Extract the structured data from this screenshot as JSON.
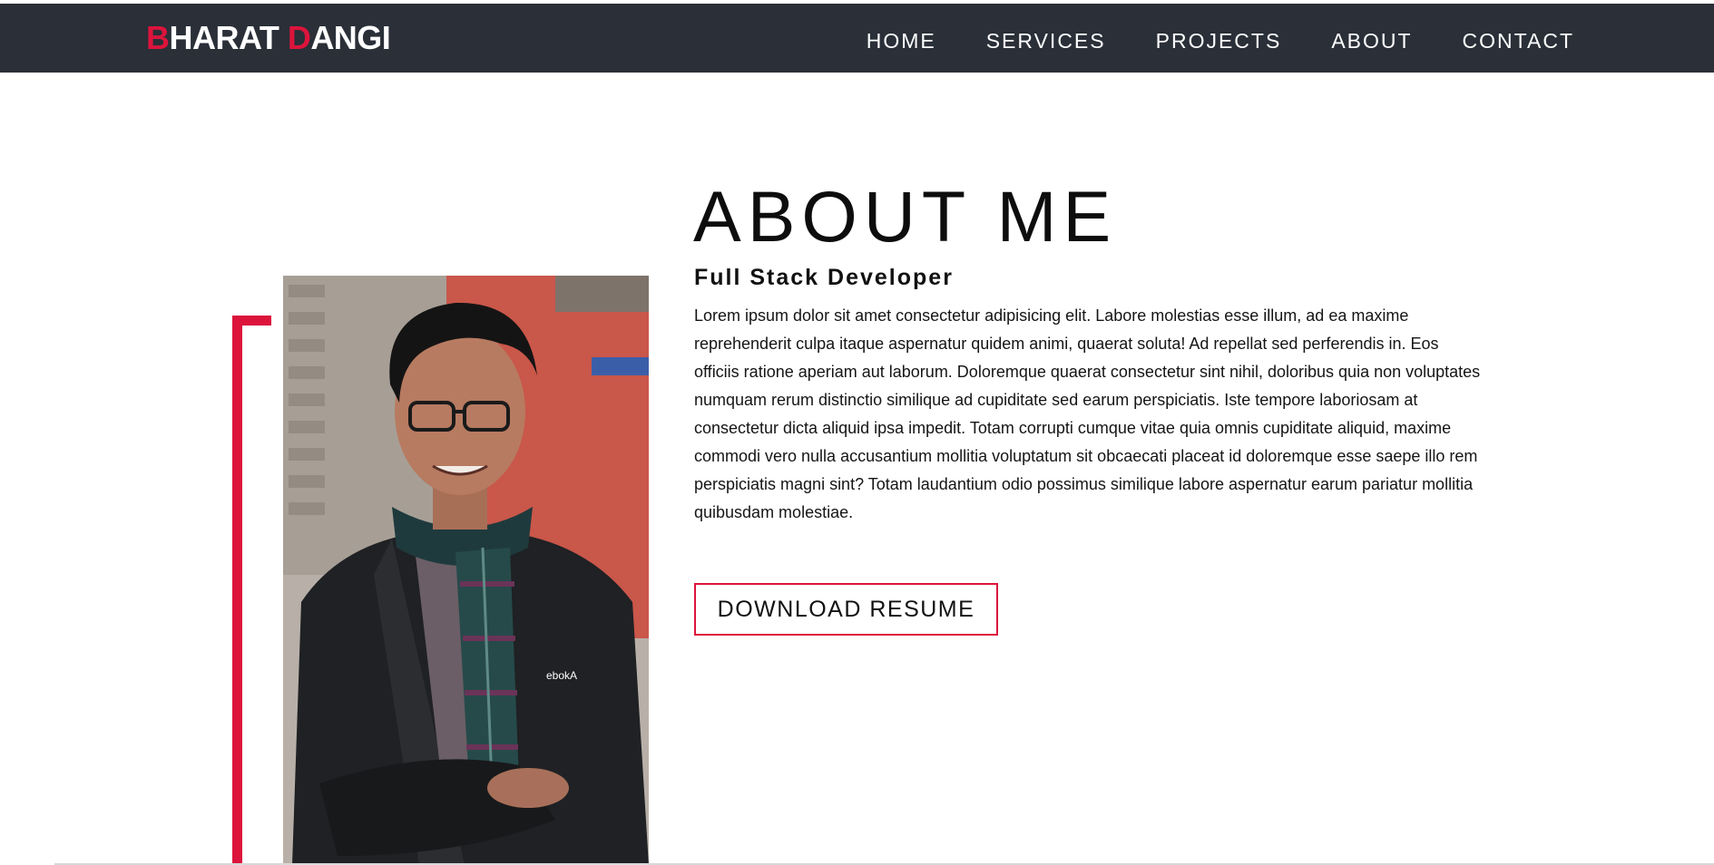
{
  "brand": {
    "first_initial": "B",
    "first_rest": "HARAT ",
    "last_initial": "D",
    "last_rest": "ANGI"
  },
  "nav": {
    "items": [
      {
        "label": "HOME"
      },
      {
        "label": "SERVICES"
      },
      {
        "label": "PROJECTS"
      },
      {
        "label": "ABOUT"
      },
      {
        "label": "CONTACT"
      }
    ]
  },
  "about": {
    "title": "ABOUT ME",
    "subtitle": "Full Stack Developer",
    "body": "Lorem ipsum dolor sit amet consectetur adipisicing elit. Labore molestias esse illum, ad ea maxime reprehenderit culpa itaque aspernatur quidem animi, quaerat soluta! Ad repellat sed perferendis in. Eos officiis ratione aperiam aut laborum. Doloremque quaerat consectetur sint nihil, doloribus quia non voluptates numquam rerum distinctio similique ad cupiditate sed earum perspiciatis. Iste tempore laboriosam at consectetur dicta aliquid ipsa impedit. Totam corrupti cumque vitae quia omnis cupiditate aliquid, maxime commodi vero nulla accusantium mollitia voluptatum sit obcaecati placeat id doloremque esse saepe illo rem perspiciatis magni sint? Totam laudantium odio possimus similique labore aspernatur earum pariatur mollitia quibusdam molestiae.",
    "button_label": "DOWNLOAD RESUME"
  },
  "colors": {
    "accent": "#dc143c",
    "navbar_bg": "#2a2f38",
    "page_bg": "#ffffff"
  },
  "icons": {
    "photo": "profile-photo"
  }
}
